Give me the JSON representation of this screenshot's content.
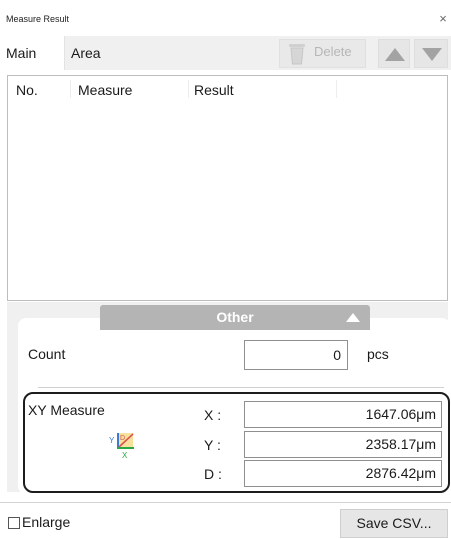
{
  "window": {
    "title": "Measure Result",
    "close_glyph": "×"
  },
  "tabs": {
    "main": "Main",
    "area": "Area"
  },
  "toolbar": {
    "delete_label": "Delete",
    "up_icon": "triangle-up-icon",
    "down_icon": "triangle-down-icon",
    "disabled_color": "#b8b8b8"
  },
  "results_table": {
    "columns": [
      "No.",
      "Measure",
      "Result"
    ],
    "rows": []
  },
  "other_section": {
    "label": "Other",
    "expanded": true
  },
  "count": {
    "label": "Count",
    "value": "0",
    "unit": "pcs"
  },
  "xy_measure": {
    "label": "XY Measure",
    "rows": [
      {
        "label": "X :",
        "value": "1647.06μm"
      },
      {
        "label": "Y :",
        "value": "2358.17μm"
      },
      {
        "label": "D :",
        "value": "2876.42μm"
      }
    ],
    "icon_axis_y": "Y",
    "icon_axis_x": "X",
    "icon_axis_d": "D"
  },
  "footer": {
    "enlarge_label": "Enlarge",
    "enlarge_checked": false,
    "save_csv_label": "Save CSV..."
  },
  "colors": {
    "section_bar": "#b4b4b4",
    "highlight_border": "#1c1c1c",
    "icon_yellow": "#f2c94c",
    "icon_red": "#d9534f",
    "icon_green": "#27a844",
    "icon_blue": "#3a7bd5"
  }
}
